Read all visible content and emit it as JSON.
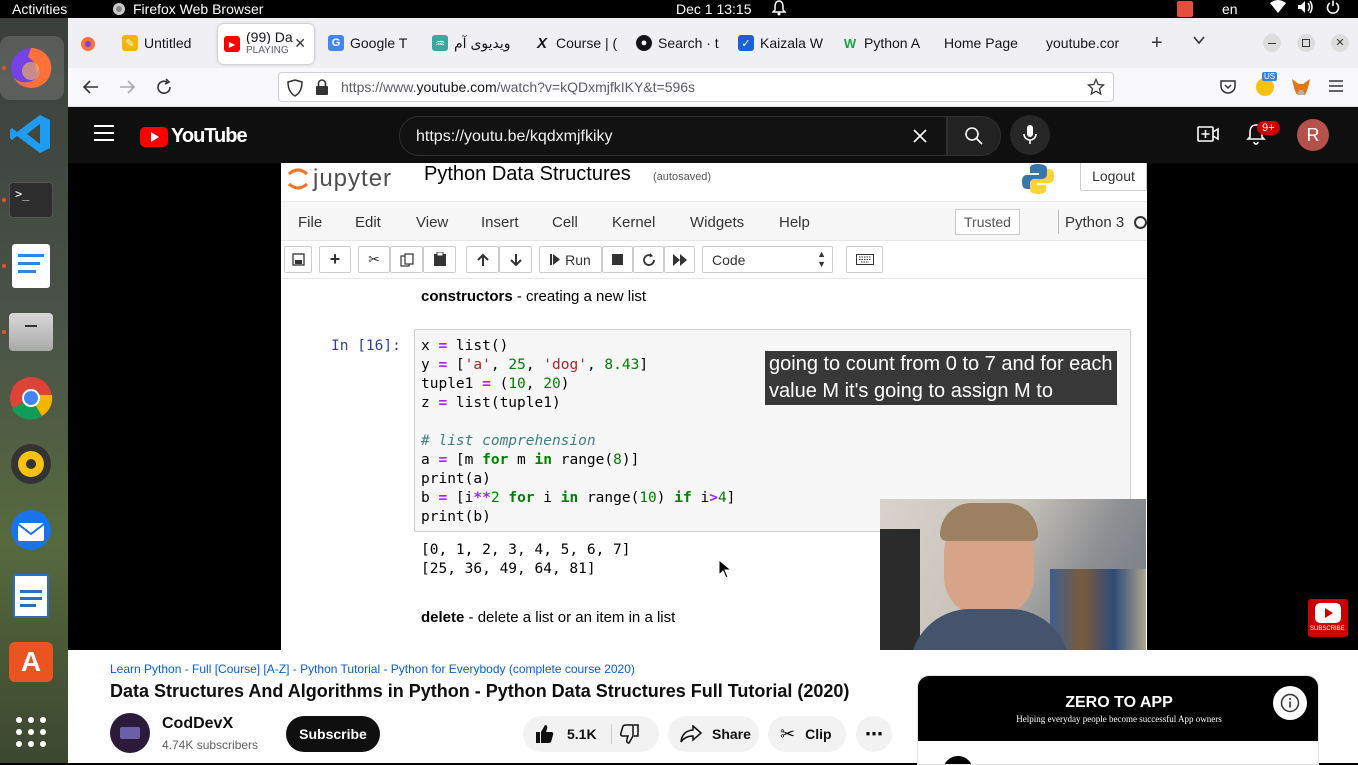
{
  "system_bar": {
    "activities": "Activities",
    "app_name": "Firefox Web Browser",
    "clock": "Dec 1  13:15",
    "language": "en"
  },
  "tabs": [
    {
      "title": "Untitled",
      "subtitle": "",
      "favicon": "docs"
    },
    {
      "title": "(99) Da",
      "subtitle": "PLAYING",
      "favicon": "youtube"
    },
    {
      "title": "Google T",
      "subtitle": "",
      "favicon": "google-translate"
    },
    {
      "title": "ویدیوی آم",
      "subtitle": "",
      "favicon": "site"
    },
    {
      "title": "Course | (",
      "subtitle": "",
      "favicon": "x-course"
    },
    {
      "title": "Search · t",
      "subtitle": "",
      "favicon": "github"
    },
    {
      "title": "Kaizala W",
      "subtitle": "",
      "favicon": "kaizala"
    },
    {
      "title": "Python A",
      "subtitle": "",
      "favicon": "w"
    },
    {
      "title": "Home Page",
      "subtitle": "",
      "favicon": "none"
    },
    {
      "title": "youtube.cor",
      "subtitle": "",
      "favicon": "none"
    }
  ],
  "url_bar": {
    "prefix": "https://www.",
    "domain": "youtube.com",
    "suffix": "/watch?v=kQDxmjfkIKY&t=596s"
  },
  "extensions": {
    "badge": "US"
  },
  "youtube_header": {
    "logo": "YouTube",
    "search_value": "https://youtu.be/kqdxmjfkiky",
    "notifications_badge": "9+",
    "avatar_letter": "R"
  },
  "notebook": {
    "brand": "jupyter",
    "title": "Python Data Structures",
    "autosaved": "(autosaved)",
    "logout": "Logout",
    "menu": [
      "File",
      "Edit",
      "View",
      "Insert",
      "Cell",
      "Kernel",
      "Widgets",
      "Help"
    ],
    "trusted": "Trusted",
    "kernel": "Python 3",
    "run_label": "Run",
    "cell_type": "Code",
    "heading1_bold": "constructors",
    "heading1_rest": " - creating a new list",
    "prompt": "In [16]:",
    "output_line1": "[0, 1, 2, 3, 4, 5, 6, 7]",
    "output_line2": "[25, 36, 49, 64, 81]",
    "heading2_bold": "delete",
    "heading2_rest": " - delete a list or an item in a list"
  },
  "captions": {
    "line1": "going to count from 0 to 7 and for each",
    "line2": "value M it's going to assign M to"
  },
  "video_info": {
    "playlist_link": "Learn Python - Full [Course] [A-Z] - Python Tutorial - Python for Everybody (complete course 2020)",
    "title": "Data Structures And Algorithms in Python - Python Data Structures Full Tutorial (2020)",
    "channel": "CodDevX",
    "subscribers": "4.74K subscribers",
    "subscribe": "Subscribe",
    "likes": "5.1K",
    "share": "Share",
    "clip": "Clip",
    "subscribe_watermark": "SUBSCRIBE"
  },
  "ad": {
    "title": "ZERO TO APP",
    "tagline": "Helping everyday people become successful App owners"
  },
  "colors": {
    "youtube_red": "#ff0000",
    "ubuntu_orange": "#e95420",
    "youtube_bg": "#0f0f0f"
  }
}
